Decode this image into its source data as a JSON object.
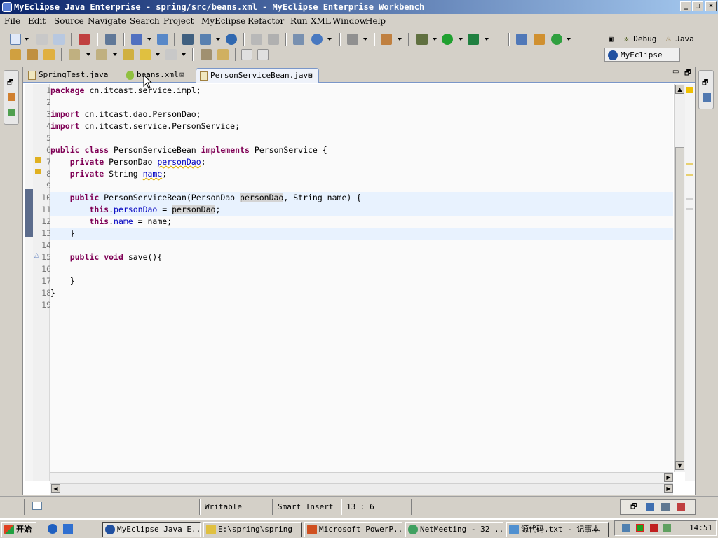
{
  "window": {
    "title": "MyEclipse Java Enterprise - spring/src/beans.xml - MyEclipse Enterprise Workbench",
    "buttons": {
      "minimize": "_",
      "maximize": "□",
      "close": "×"
    }
  },
  "menu": [
    "File",
    "Edit",
    "Source",
    "Navigate",
    "Search",
    "Project",
    "MyEclipse",
    "Refactor",
    "Run",
    "XML",
    "Window",
    "Help"
  ],
  "perspectives": {
    "debug": "Debug",
    "java": "Java",
    "myeclipse": "MyEclipse ..."
  },
  "tabs": [
    {
      "label": "SpringTest.java",
      "active": false
    },
    {
      "label": "beans.xml",
      "active": false,
      "close": "⊠"
    },
    {
      "label": "PersonServiceBean.java",
      "active": true,
      "close": "⊠"
    }
  ],
  "code": {
    "line_numbers": [
      "1",
      "2",
      "3",
      "4",
      "5",
      "6",
      "7",
      "8",
      "9",
      "10",
      "11",
      "12",
      "13",
      "14",
      "15",
      "16",
      "17",
      "18",
      "19"
    ],
    "l1": {
      "kw": "package",
      "rest": " cn.itcast.service.impl;"
    },
    "l3": {
      "kw": "import",
      "rest": " cn.itcast.dao.PersonDao;"
    },
    "l4": {
      "kw": "import",
      "rest": " cn.itcast.service.PersonService;"
    },
    "l6": {
      "kw1": "public",
      "kw2": "class",
      "name": " PersonServiceBean ",
      "kw3": "implements",
      "rest": " PersonService {"
    },
    "l7": {
      "kw": "private",
      "type": " PersonDao ",
      "field": "personDao",
      "end": ";"
    },
    "l8": {
      "kw": "private",
      "type": " String ",
      "field": "name",
      "end": ";"
    },
    "l10": {
      "kw": "public",
      "a": " PersonServiceBean(PersonDao ",
      "occ": "personDao",
      "b": ", String name) {"
    },
    "l11": {
      "kw": "this",
      "dot": ".",
      "field": "personDao",
      "eq": " = ",
      "occ": "personDao",
      "end": ";"
    },
    "l12": {
      "kw": "this",
      "dot": ".",
      "field": "name",
      "rest": " = name;"
    },
    "l13": "}",
    "l15": {
      "kw1": "public",
      "kw2": "void",
      "rest": " save(){"
    },
    "l17": "}",
    "l18": "}"
  },
  "status": {
    "writable": "Writable",
    "insert_mode": "Smart Insert",
    "position": "13 : 6"
  },
  "taskbar": {
    "start": "开始",
    "items": [
      {
        "label": "MyEclipse Java E...",
        "pressed": true
      },
      {
        "label": "E:\\spring\\spring",
        "pressed": false
      },
      {
        "label": "Microsoft PowerP...",
        "pressed": false
      },
      {
        "label": "NetMeeting - 32 ...",
        "pressed": false
      },
      {
        "label": "源代码.txt - 记事本",
        "pressed": false
      }
    ],
    "clock": "14:51"
  }
}
